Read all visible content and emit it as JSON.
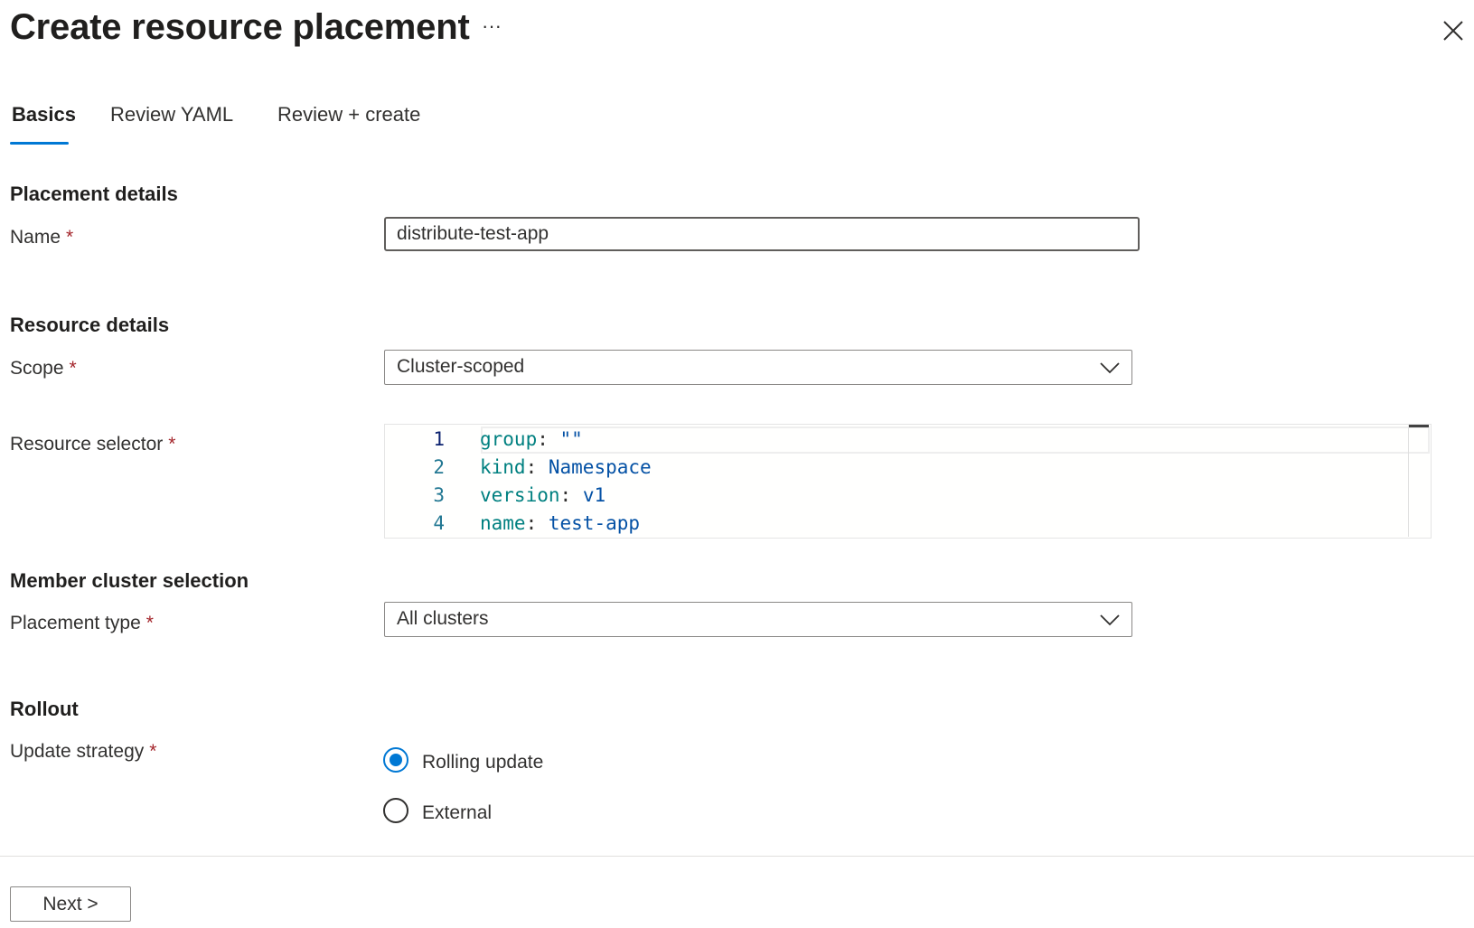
{
  "header": {
    "title": "Create resource placement",
    "more_label": "···",
    "close_icon": "close-icon"
  },
  "tabs": [
    {
      "label": "Basics",
      "active": true
    },
    {
      "label": "Review YAML",
      "active": false
    },
    {
      "label": "Review + create",
      "active": false
    }
  ],
  "placement_details": {
    "heading": "Placement details",
    "name_label": "Name",
    "required_mark": "*",
    "name_value": "distribute-test-app"
  },
  "resource_details": {
    "heading": "Resource details",
    "scope_label": "Scope",
    "scope_value": "Cluster-scoped",
    "selector_label": "Resource selector",
    "selector_lines": [
      {
        "num": "1",
        "key": "group",
        "sep": ": ",
        "value": "\"\""
      },
      {
        "num": "2",
        "key": "kind",
        "sep": ": ",
        "value": "Namespace"
      },
      {
        "num": "3",
        "key": "version",
        "sep": ": ",
        "value": "v1"
      },
      {
        "num": "4",
        "key": "name",
        "sep": ": ",
        "value": "test-app"
      }
    ]
  },
  "member_cluster": {
    "heading": "Member cluster selection",
    "placement_type_label": "Placement type",
    "placement_type_value": "All clusters"
  },
  "rollout": {
    "heading": "Rollout",
    "strategy_label": "Update strategy",
    "options": [
      {
        "label": "Rolling update",
        "selected": true
      },
      {
        "label": "External",
        "selected": false
      }
    ]
  },
  "footer": {
    "next_label": "Next >"
  },
  "colors": {
    "accent": "#0078d4",
    "required": "#a4262c",
    "yaml_key": "#008080",
    "yaml_value": "#0451a5",
    "line_number": "#237893"
  }
}
